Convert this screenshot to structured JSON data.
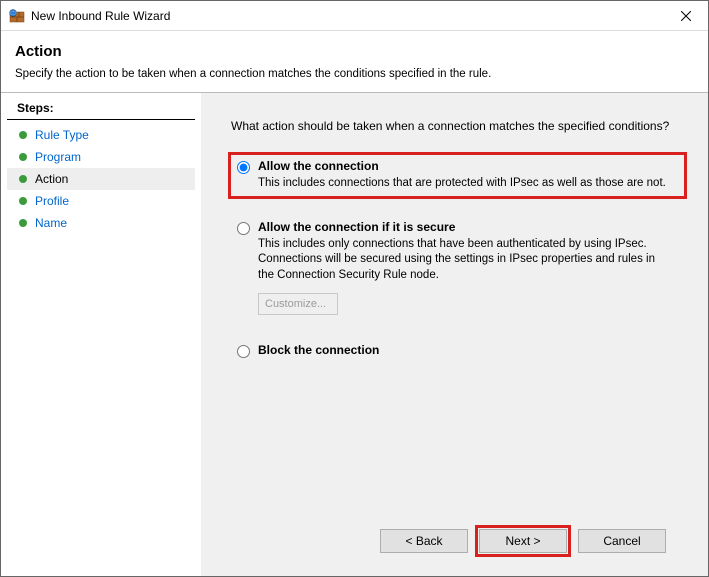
{
  "titlebar": {
    "title": "New Inbound Rule Wizard"
  },
  "header": {
    "page_title": "Action",
    "subtitle": "Specify the action to be taken when a connection matches the conditions specified in the rule."
  },
  "steps": {
    "header": "Steps:",
    "items": [
      {
        "label": "Rule Type",
        "current": false
      },
      {
        "label": "Program",
        "current": false
      },
      {
        "label": "Action",
        "current": true
      },
      {
        "label": "Profile",
        "current": false
      },
      {
        "label": "Name",
        "current": false
      }
    ]
  },
  "main": {
    "prompt": "What action should be taken when a connection matches the specified conditions?",
    "options": [
      {
        "id": "allow",
        "label": "Allow the connection",
        "desc": "This includes connections that are protected with IPsec as well as those are not.",
        "selected": true,
        "highlighted": true
      },
      {
        "id": "allow-secure",
        "label": "Allow the connection if it is secure",
        "desc": "This includes only connections that have been authenticated by using IPsec.  Connections will be secured using the settings in IPsec properties and rules in the Connection Security Rule node.",
        "selected": false,
        "customize_label": "Customize...",
        "customize_enabled": false
      },
      {
        "id": "block",
        "label": "Block the connection",
        "desc": "",
        "selected": false
      }
    ]
  },
  "footer": {
    "back": "< Back",
    "next": "Next >",
    "cancel": "Cancel",
    "next_highlighted": true
  },
  "colors": {
    "highlight": "#d8201f",
    "link": "#0066cc",
    "panel_bg": "#f0f0f0"
  }
}
